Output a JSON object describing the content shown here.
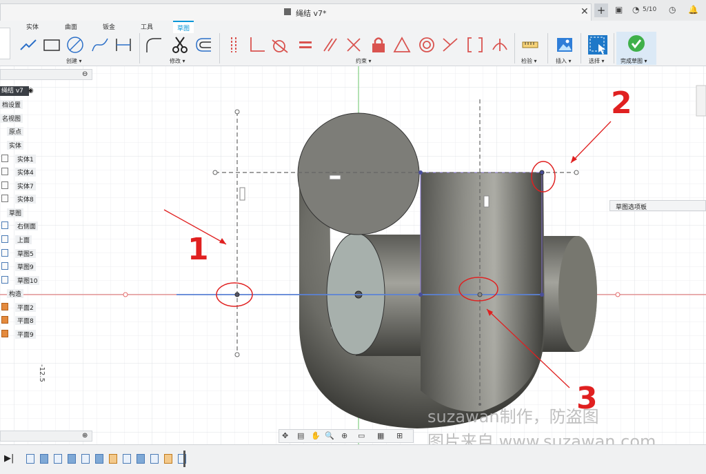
{
  "window": {
    "doc_title": "绳结 v7*",
    "job_count": "5/10"
  },
  "ribbon": {
    "tabs": [
      {
        "label": "实体",
        "active": false
      },
      {
        "label": "曲面",
        "active": false
      },
      {
        "label": "钣金",
        "active": false
      },
      {
        "label": "工具",
        "active": false
      },
      {
        "label": "草图",
        "active": true
      }
    ],
    "groups": {
      "create": "创建 ▾",
      "modify": "修改 ▾",
      "constraints": "约束 ▾",
      "inspect": "检验 ▾",
      "insert": "插入 ▾",
      "select": "选择 ▾",
      "finish": "完成草图 ▾"
    }
  },
  "browser": {
    "root": "绳结 v7",
    "items": [
      {
        "label": "档设置",
        "icon": "none"
      },
      {
        "label": "名视图",
        "icon": "none"
      },
      {
        "label": "原点",
        "icon": "none"
      },
      {
        "label": "实体",
        "icon": "none"
      },
      {
        "label": "实体1",
        "icon": "body-icon"
      },
      {
        "label": "实体4",
        "icon": "body-icon"
      },
      {
        "label": "实体7",
        "icon": "body-icon"
      },
      {
        "label": "实体8",
        "icon": "body-icon"
      },
      {
        "label": "草图",
        "icon": "none"
      },
      {
        "label": "右侧面",
        "icon": "sketch-icon"
      },
      {
        "label": "上面",
        "icon": "sketch-icon"
      },
      {
        "label": "草图5",
        "icon": "sketch-icon"
      },
      {
        "label": "草图9",
        "icon": "sketch-icon"
      },
      {
        "label": "草图10",
        "icon": "sketch-icon"
      },
      {
        "label": "构造",
        "icon": "none"
      },
      {
        "label": "平面2",
        "icon": "plane-icon"
      },
      {
        "label": "平面8",
        "icon": "plane-icon"
      },
      {
        "label": "平面9",
        "icon": "plane-icon"
      }
    ]
  },
  "viewport": {
    "sketch_palette": "草图选项板",
    "dimension_value": "-12.5",
    "annotations": [
      "1",
      "2",
      "3"
    ],
    "watermark_line1": "suzawan制作，防盗图",
    "watermark_line2": "图片来自 www.suzawan.com"
  },
  "colors": {
    "accent": "#0696d7",
    "annotation_red": "#e02020",
    "axis_red": "#e46a6a",
    "axis_green": "#6ac46a",
    "sketch_blue": "#5b82d6",
    "finish_green": "#3fb04a"
  }
}
